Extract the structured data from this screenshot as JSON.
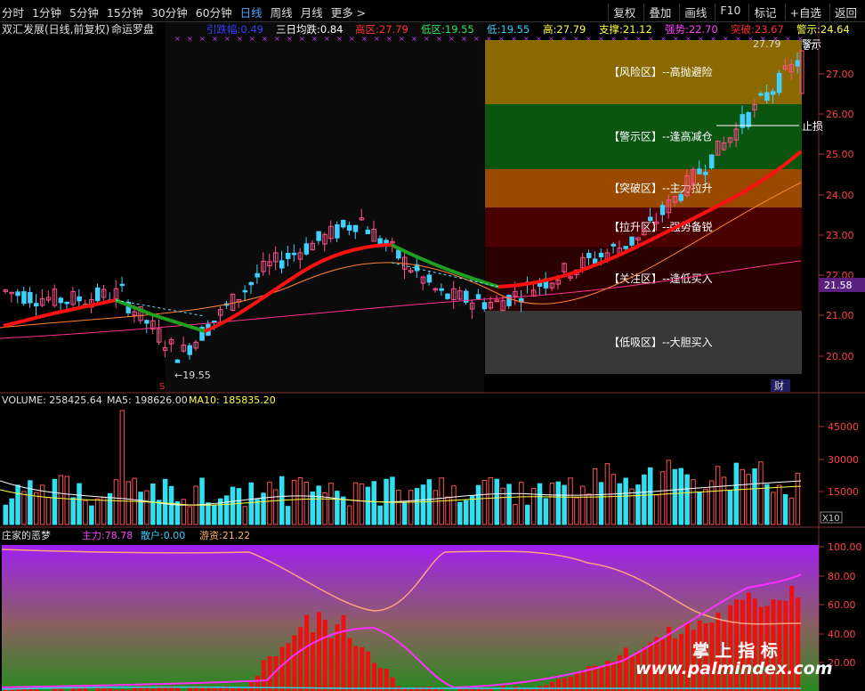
{
  "toolbar": {
    "periods": [
      "分时",
      "1分钟",
      "5分钟",
      "15分钟",
      "30分钟",
      "60分钟",
      "日线",
      "周线",
      "月线",
      "更多 >"
    ],
    "active_period": "日线",
    "buttons": [
      "复权",
      "叠加",
      "画线",
      "F10",
      "标记",
      "+自选",
      "返回"
    ]
  },
  "main_panel": {
    "title": "双汇发展(日线,前复权)",
    "indicator_name": "命运罗盘",
    "indicators": [
      {
        "label": "引跌幅:",
        "value": "0.49",
        "color": "#3a3aff"
      },
      {
        "label": "三日均跌:",
        "value": "0.84",
        "color": "#ffffff"
      },
      {
        "label": "高区:",
        "value": "27.79",
        "color": "#ff3030"
      },
      {
        "label": "低区:",
        "value": "19.55",
        "color": "#30e060"
      },
      {
        "label": "低:",
        "value": "19.55",
        "color": "#30d0ff"
      },
      {
        "label": "高:",
        "value": "27.79",
        "color": "#ffff40"
      },
      {
        "label": "支撑:",
        "value": "21.12",
        "color": "#ffff40"
      },
      {
        "label": "强势:",
        "value": "22.70",
        "color": "#ff40ff"
      },
      {
        "label": "突破:",
        "value": "23.67",
        "color": "#ff3030"
      },
      {
        "label": "警示:",
        "value": "24.64",
        "color": "#ffff40"
      }
    ],
    "zones": [
      {
        "label": "【风险区】--高抛避险",
        "color": "#8a6a00"
      },
      {
        "label": "【警示区】--逢高减仓",
        "color": "#0a5510"
      },
      {
        "label": "【突破区】--主力拉升",
        "color": "#9a4a00"
      },
      {
        "label": "【拉升区】--强势备锐",
        "color": "#4a0000"
      },
      {
        "label": "【关注区】--逢低买入",
        "color": "#2a0000"
      },
      {
        "label": "【低吸区】--大胆买入",
        "color": "#383838"
      }
    ],
    "price_axis": [
      "27.00",
      "26.00",
      "25.00",
      "24.00",
      "23.00",
      "22.00",
      "21.00",
      "20.00"
    ],
    "current_price": "21.58",
    "high_label": "27.79",
    "high_label_right": "27.",
    "low_label": "19.55",
    "stop_label": "止损",
    "caution_label": "警示",
    "finance_marker": "财",
    "s_marker": "S"
  },
  "volume_panel": {
    "label_volume": "VOLUME:",
    "value_volume": "258425.64",
    "label_ma5": "MA5:",
    "value_ma5": "198626.00",
    "label_ma10": "MA10:",
    "value_ma10": "185835.20",
    "axis": [
      "45000",
      "30000",
      "15000"
    ],
    "unit": "X10"
  },
  "bottom_panel": {
    "title": "庄家的恶梦",
    "indicators": [
      {
        "label": "主力:",
        "value": "78.78",
        "color": "#ff40ff"
      },
      {
        "label": "散户:",
        "value": "0.00",
        "color": "#30d0ff"
      },
      {
        "label": "游资:",
        "value": "21.22",
        "color": "#ffb060"
      }
    ],
    "axis": [
      "100.00",
      "80.00",
      "60.00",
      "40.00",
      "20.00"
    ]
  },
  "watermark": {
    "line1": "掌 上 指 标",
    "line2": "www.palmindex.com"
  }
}
